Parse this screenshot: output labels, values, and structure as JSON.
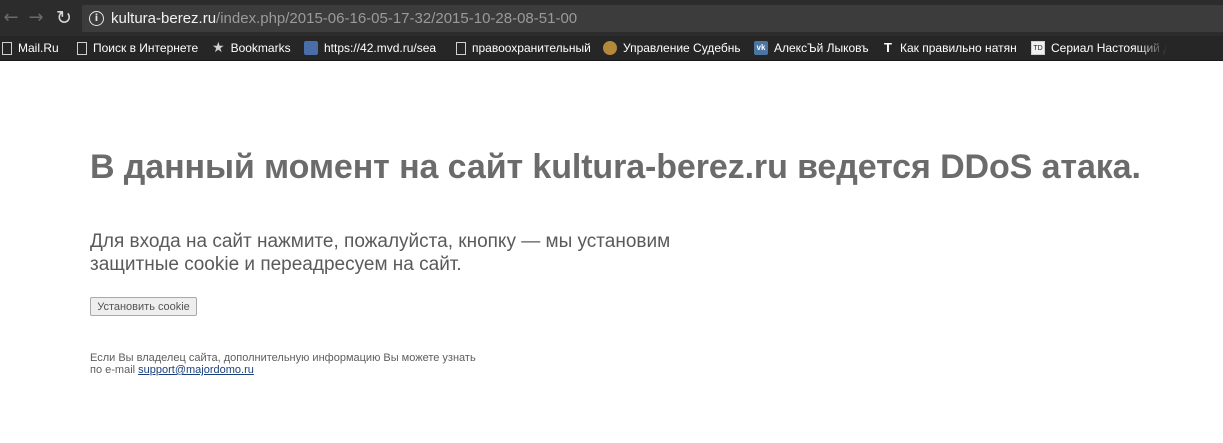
{
  "browser": {
    "url_host": "kultura-berez.ru",
    "url_path": "/index.php/2015-06-16-05-17-32/2015-10-28-08-51-00",
    "back_icon": "arrow-left-icon",
    "forward_icon": "arrow-right-icon",
    "reload_icon": "reload-icon",
    "info_icon": "info-icon"
  },
  "bookmarks": [
    {
      "label": "Mail.Ru",
      "icon": "page-icon"
    },
    {
      "label": "Поиск в Интернете",
      "icon": "page-icon"
    },
    {
      "label": "Bookmarks",
      "icon": "star-icon"
    },
    {
      "label": "https://42.mvd.ru/sea",
      "icon": "site-icon"
    },
    {
      "label": "правоохранительный",
      "icon": "page-icon"
    },
    {
      "label": "Управление Судебны",
      "icon": "emblem-icon"
    },
    {
      "label": "АлексЪй Лыковъ",
      "icon": "vk-icon"
    },
    {
      "label": "Как правильно натян",
      "icon": "t-icon"
    },
    {
      "label": "Сериал Настоящий д",
      "icon": "td-icon"
    }
  ],
  "page": {
    "headline": "В данный момент на сайт kultura-berez.ru ведется DDoS атака.",
    "message": "Для входа на сайт нажмите, пожалуйста, кнопку — мы установим защитные cookie и переадресуем на сайт.",
    "button_label": "Установить cookie",
    "note_line1": "Если Вы владелец сайта, дополнительную информацию Вы можете узнать",
    "note_prefix": "по e-mail ",
    "support_email": "support@majordomo.ru"
  },
  "colors": {
    "toolbar_bg": "#2c2c2c",
    "bookmarks_bg": "#262626",
    "headline": "#6b6b6b",
    "link": "#1a3f7c"
  }
}
